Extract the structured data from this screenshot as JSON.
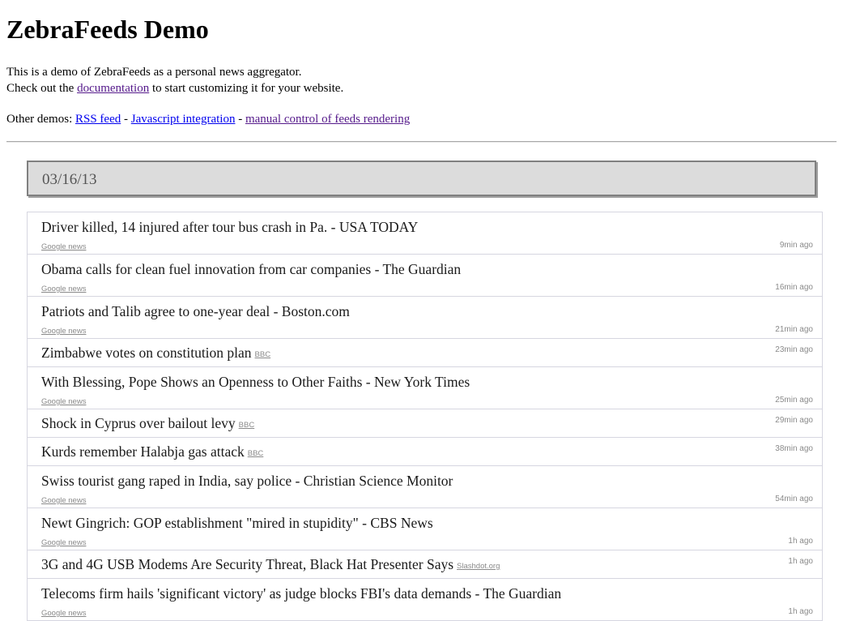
{
  "header": {
    "title": "ZebraFeeds Demo"
  },
  "intro": {
    "line1": "This is a demo of ZebraFeeds as a personal news aggregator.",
    "line2_pre": "Check out the ",
    "documentation_link": "documentation",
    "line2_post": " to start customizing it for your website.",
    "other_demos_label": "Other demos: ",
    "rss_link": "RSS feed",
    "separator": " - ",
    "js_link": "Javascript integration",
    "manual_link": "manual control of feeds rendering"
  },
  "feed": {
    "date_header": "03/16/13",
    "items": [
      {
        "title": "Driver killed, 14 injured after tour bus crash in Pa. - USA TODAY",
        "source": "Google news",
        "source_inline": false,
        "age": "9min ago"
      },
      {
        "title": "Obama calls for clean fuel innovation from car companies - The Guardian",
        "source": "Google news",
        "source_inline": false,
        "age": "16min ago"
      },
      {
        "title": "Patriots and Talib agree to one-year deal - Boston.com",
        "source": "Google news",
        "source_inline": false,
        "age": "21min ago"
      },
      {
        "title": "Zimbabwe votes on constitution plan",
        "source": "BBC",
        "source_inline": true,
        "age": "23min ago"
      },
      {
        "title": "With Blessing, Pope Shows an Openness to Other Faiths - New York Times",
        "source": "Google news",
        "source_inline": false,
        "age": "25min ago"
      },
      {
        "title": "Shock in Cyprus over bailout levy",
        "source": "BBC",
        "source_inline": true,
        "age": "29min ago"
      },
      {
        "title": "Kurds remember Halabja gas attack",
        "source": "BBC",
        "source_inline": true,
        "age": "38min ago"
      },
      {
        "title": "Swiss tourist gang raped in India, say police - Christian Science Monitor",
        "source": "Google news",
        "source_inline": false,
        "age": "54min ago"
      },
      {
        "title": "Newt Gingrich: GOP establishment \"mired in stupidity\" - CBS News",
        "source": "Google news",
        "source_inline": false,
        "age": "1h ago"
      },
      {
        "title": "3G and 4G USB Modems Are Security Threat, Black Hat Presenter Says",
        "source": "Slashdot.org",
        "source_inline": true,
        "age": "1h ago"
      },
      {
        "title": "Telecoms firm hails 'significant victory' as judge blocks FBI's data demands - The Guardian",
        "source": "Google news",
        "source_inline": false,
        "age": "1h ago"
      }
    ]
  }
}
